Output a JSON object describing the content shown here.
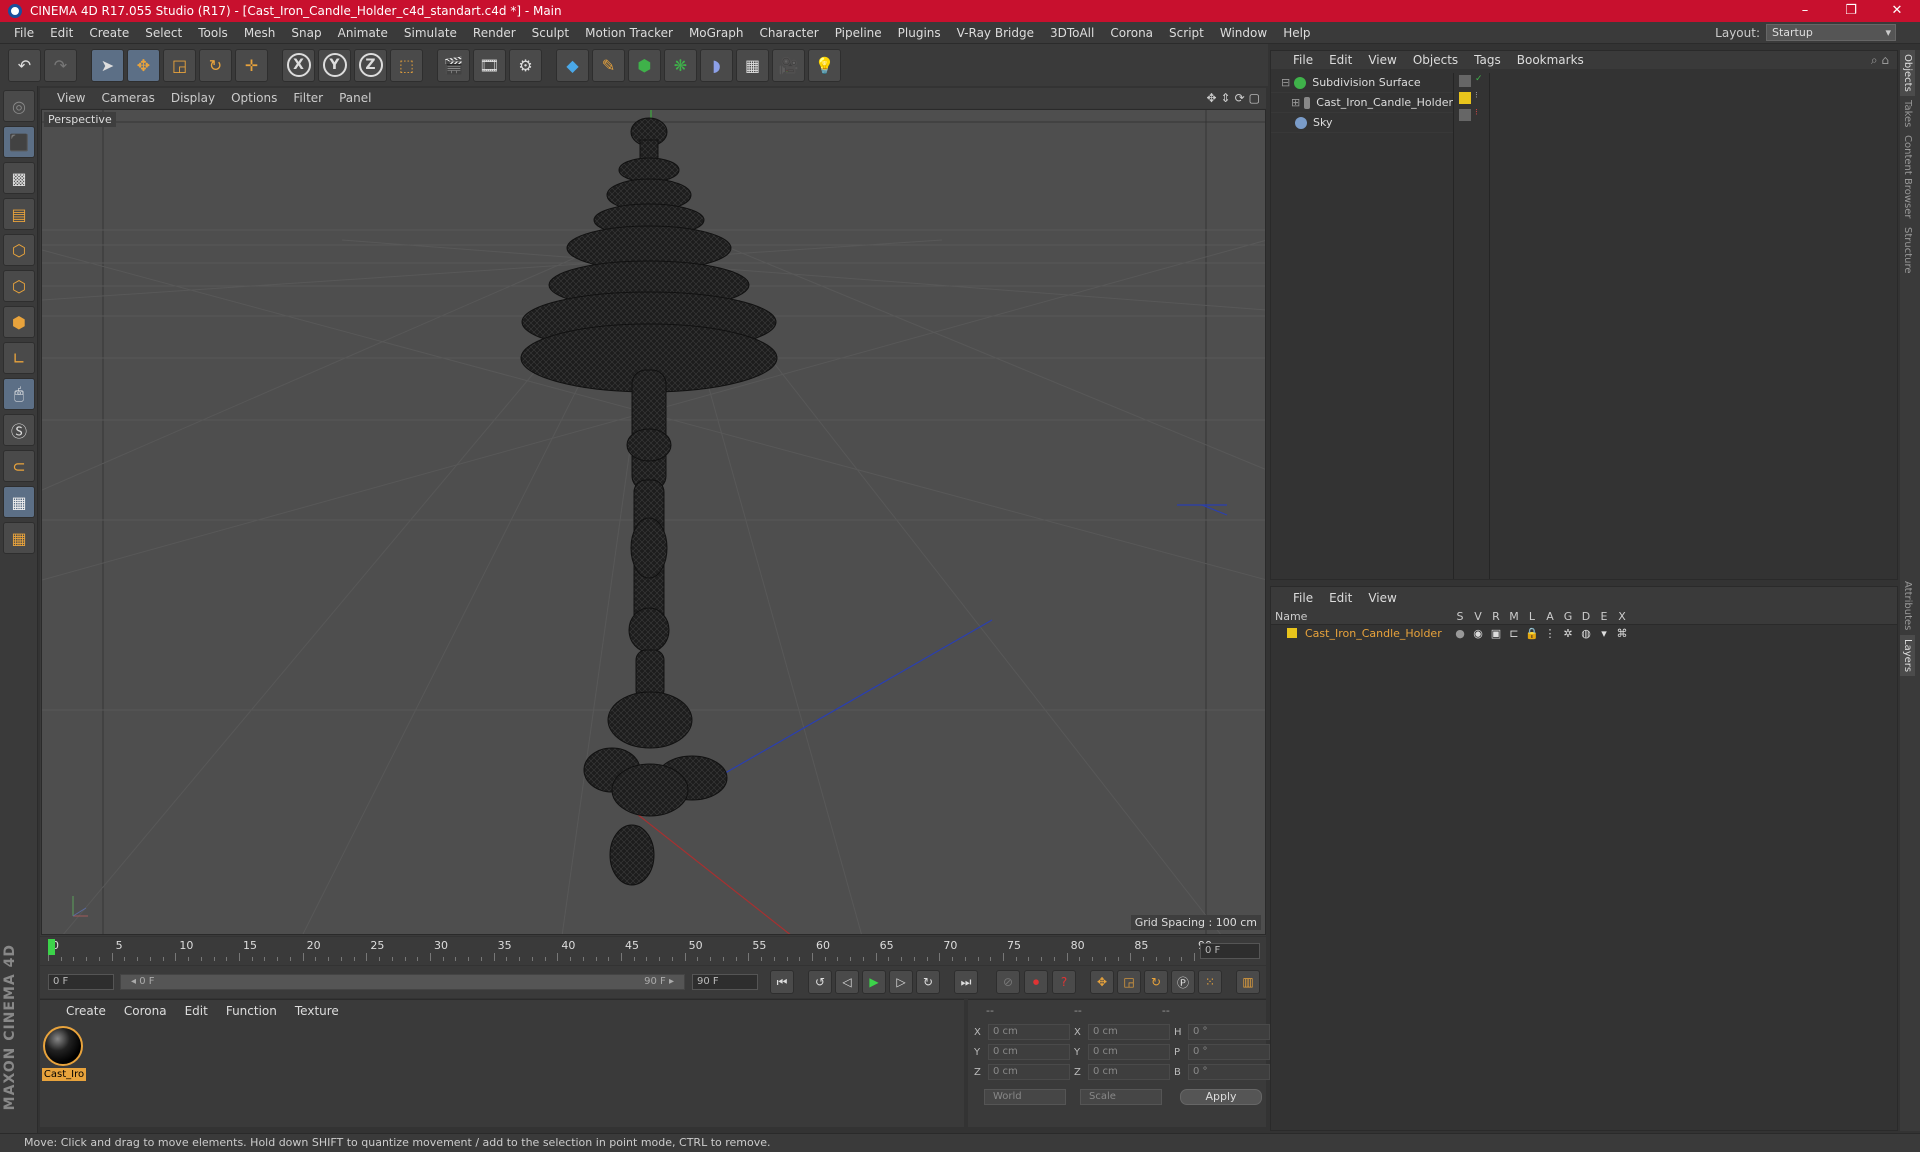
{
  "window": {
    "title": "CINEMA 4D R17.055 Studio (R17) - [Cast_Iron_Candle_Holder_c4d_standart.c4d *] - Main",
    "controls": [
      "–",
      "❐",
      "✕"
    ]
  },
  "menubar": {
    "items": [
      "File",
      "Edit",
      "Create",
      "Select",
      "Tools",
      "Mesh",
      "Snap",
      "Animate",
      "Simulate",
      "Render",
      "Sculpt",
      "Motion Tracker",
      "MoGraph",
      "Character",
      "Pipeline",
      "Plugins",
      "V-Ray Bridge",
      "3DToAll",
      "Corona",
      "Script",
      "Window",
      "Help"
    ],
    "layout_label": "Layout:",
    "layout_value": "Startup"
  },
  "toolbar": {
    "axis_x": "X",
    "axis_y": "Y",
    "axis_z": "Z"
  },
  "viewport": {
    "menu": [
      "View",
      "Cameras",
      "Display",
      "Options",
      "Filter",
      "Panel"
    ],
    "label": "Perspective",
    "grid_spacing": "Grid Spacing : 100 cm"
  },
  "timeline": {
    "ticks": [
      "0",
      "5",
      "10",
      "15",
      "20",
      "25",
      "30",
      "35",
      "40",
      "45",
      "50",
      "55",
      "60",
      "65",
      "70",
      "75",
      "80",
      "85",
      "90"
    ],
    "current_frame": "0 F"
  },
  "transport": {
    "start_field": "0 F",
    "slider_left": "◂ 0 F",
    "slider_right": "90 F ▸",
    "end_field": "90 F"
  },
  "material_panel": {
    "menu": [
      "Create",
      "Corona",
      "Edit",
      "Function",
      "Texture"
    ],
    "material_name": "Cast_Iro"
  },
  "coords": {
    "headers": [
      "--",
      "--",
      "--"
    ],
    "rows": [
      {
        "a_label": "X",
        "a_val": "0 cm",
        "b_label": "X",
        "b_val": "0 cm",
        "c_label": "H",
        "c_val": "0 °"
      },
      {
        "a_label": "Y",
        "a_val": "0 cm",
        "b_label": "Y",
        "b_val": "0 cm",
        "c_label": "P",
        "c_val": "0 °"
      },
      {
        "a_label": "Z",
        "a_val": "0 cm",
        "b_label": "Z",
        "b_val": "0 cm",
        "c_label": "B",
        "c_val": "0 °"
      }
    ],
    "coord_system": "World",
    "mode": "Scale",
    "apply_label": "Apply"
  },
  "object_manager": {
    "menu": [
      "File",
      "Edit",
      "View",
      "Objects",
      "Tags",
      "Bookmarks"
    ],
    "objects": [
      {
        "name": "Subdivision Surface",
        "color": "#3fb24a"
      },
      {
        "name": "Cast_Iron_Candle_Holder",
        "color": "#888888"
      },
      {
        "name": "Sky",
        "color": "#7a9cc9"
      }
    ]
  },
  "layer_manager": {
    "menu": [
      "File",
      "Edit",
      "View"
    ],
    "columns": [
      "Name",
      "S",
      "V",
      "R",
      "M",
      "L",
      "A",
      "G",
      "D",
      "E",
      "X"
    ],
    "layers": [
      {
        "name": "Cast_Iron_Candle_Holder",
        "color": "#e8c41c"
      }
    ]
  },
  "side_tabs": {
    "top": [
      "Objects",
      "Takes",
      "Content Browser",
      "Structure"
    ],
    "bottom": [
      "Attributes",
      "Layers"
    ]
  },
  "status": {
    "text": "Move: Click and drag to move elements. Hold down SHIFT to quantize movement / add to the selection in point mode, CTRL to remove."
  },
  "brand": {
    "maxon": "MAXON CINEMA 4D"
  },
  "colors": {
    "title_bar": "#c8102e",
    "accent": "#e8a33c",
    "layer_name": "#e8a33c"
  }
}
